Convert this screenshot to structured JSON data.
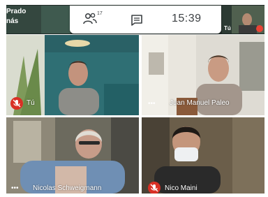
{
  "top_bar": {
    "self_name_line1": "Prado",
    "self_name_line2": "nás",
    "participants_count": "17",
    "clock": "15:39",
    "mini_tile_label": "Tú"
  },
  "tiles": [
    {
      "name": "Tú",
      "muted": true
    },
    {
      "name": "Juan Manuel Paleo",
      "muted": false
    },
    {
      "name": "Nicolas Schweigmann",
      "muted": false
    },
    {
      "name": "Nico Maini",
      "muted": true
    }
  ],
  "colors": {
    "mute_red": "#d93025"
  }
}
